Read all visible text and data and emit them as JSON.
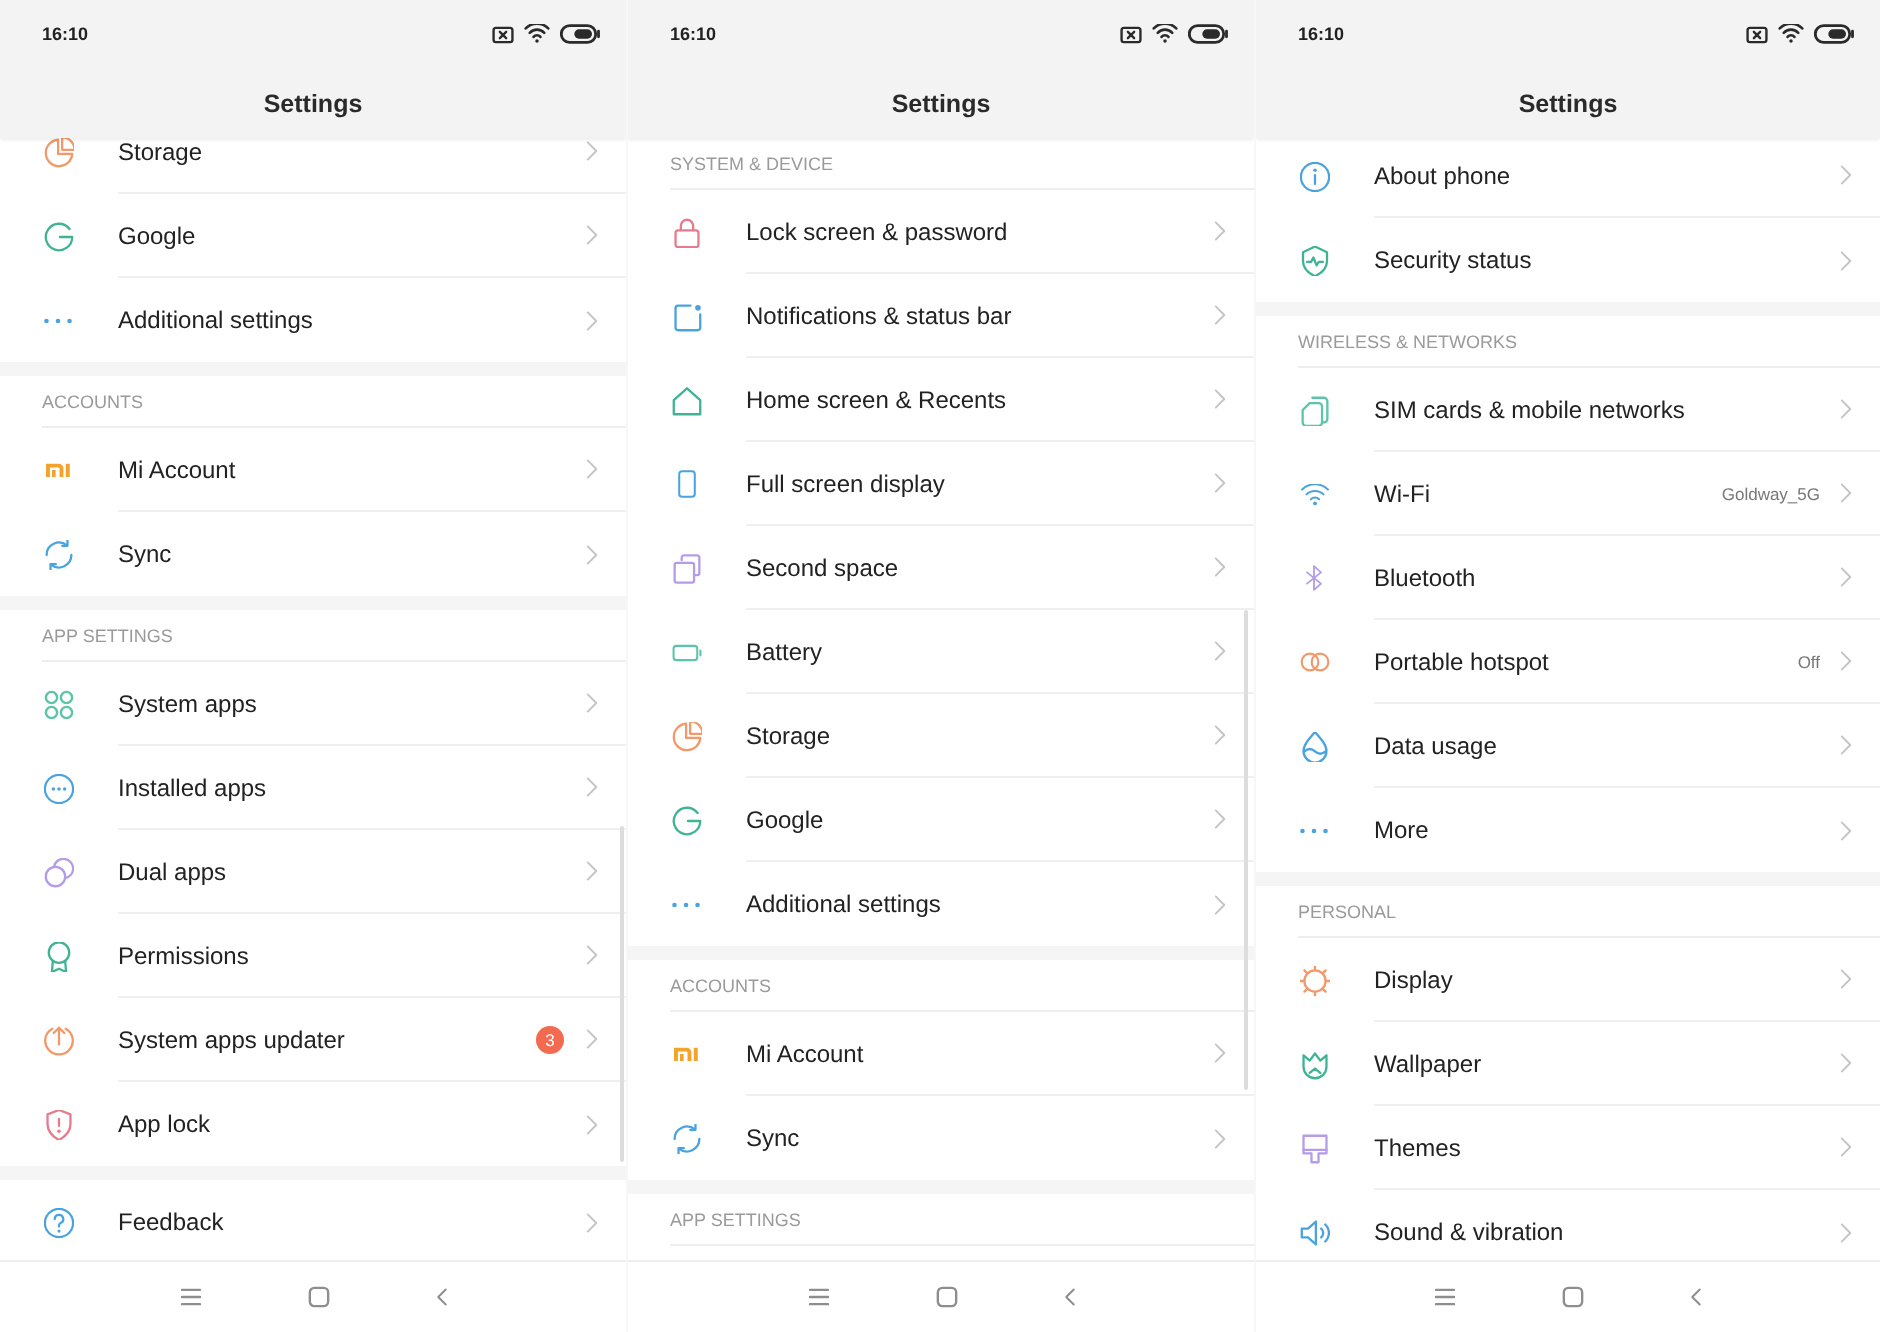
{
  "screens": [
    {
      "status_bar": {
        "time": "16:10"
      },
      "title": "Settings",
      "sections": [
        {
          "items": [
            {
              "label": "Storage"
            },
            {
              "label": "Google"
            },
            {
              "label": "Additional settings"
            }
          ]
        },
        {
          "header": "ACCOUNTS",
          "items": [
            {
              "label": "Mi Account"
            },
            {
              "label": "Sync"
            }
          ]
        },
        {
          "header": "APP SETTINGS",
          "items": [
            {
              "label": "System apps"
            },
            {
              "label": "Installed apps"
            },
            {
              "label": "Dual apps"
            },
            {
              "label": "Permissions"
            },
            {
              "label": "System apps updater",
              "badge": "3"
            },
            {
              "label": "App lock"
            }
          ]
        },
        {
          "items": [
            {
              "label": "Feedback"
            }
          ]
        }
      ]
    },
    {
      "status_bar": {
        "time": "16:10"
      },
      "title": "Settings",
      "sections": [
        {
          "header": "SYSTEM & DEVICE",
          "items": [
            {
              "label": "Lock screen & password"
            },
            {
              "label": "Notifications & status bar"
            },
            {
              "label": "Home screen & Recents"
            },
            {
              "label": "Full screen display"
            },
            {
              "label": "Second space"
            },
            {
              "label": "Battery"
            },
            {
              "label": "Storage"
            },
            {
              "label": "Google"
            },
            {
              "label": "Additional settings"
            }
          ]
        },
        {
          "header": "ACCOUNTS",
          "items": [
            {
              "label": "Mi Account"
            },
            {
              "label": "Sync"
            }
          ]
        },
        {
          "header": "APP SETTINGS"
        }
      ]
    },
    {
      "status_bar": {
        "time": "16:10"
      },
      "title": "Settings",
      "sections": [
        {
          "items": [
            {
              "label": "About phone"
            },
            {
              "label": "Security status"
            }
          ]
        },
        {
          "header": "WIRELESS & NETWORKS",
          "items": [
            {
              "label": "SIM cards & mobile networks"
            },
            {
              "label": "Wi-Fi",
              "value": "Goldway_5G"
            },
            {
              "label": "Bluetooth"
            },
            {
              "label": "Portable hotspot",
              "value": "Off"
            },
            {
              "label": "Data usage"
            },
            {
              "label": "More"
            }
          ]
        },
        {
          "header": "PERSONAL",
          "items": [
            {
              "label": "Display"
            },
            {
              "label": "Wallpaper"
            },
            {
              "label": "Themes"
            },
            {
              "label": "Sound & vibration"
            }
          ]
        }
      ]
    }
  ]
}
